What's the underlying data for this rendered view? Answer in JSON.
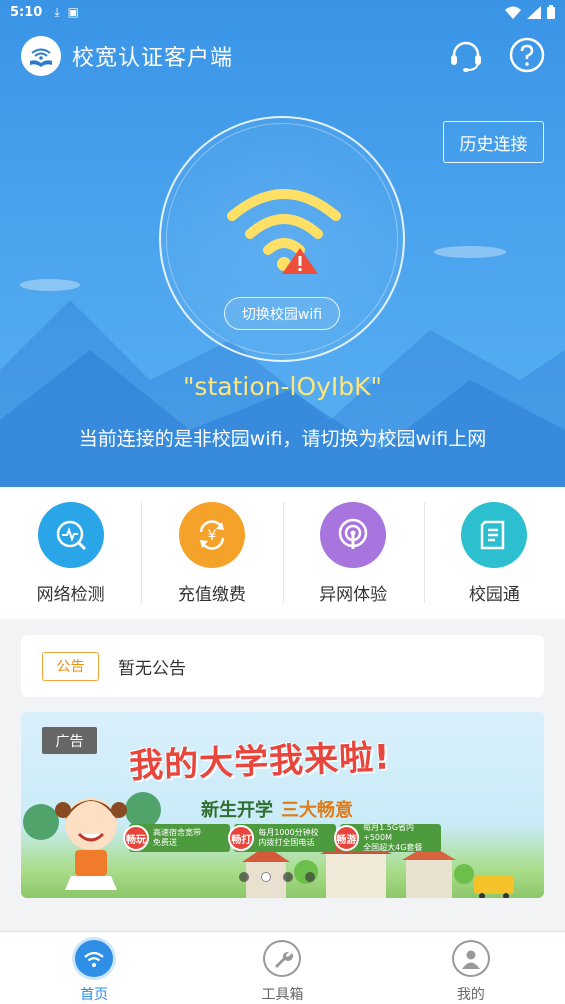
{
  "status_bar": {
    "time": "5:10"
  },
  "header": {
    "title": "校宽认证客户端",
    "support_icon": "headset-icon",
    "help_icon": "question-icon",
    "history_button": "历史连接"
  },
  "connection": {
    "switch_button": "切换校园wifi",
    "ssid": "\"station-lOyIbK\"",
    "message": "当前连接的是非校园wifi，请切换为校园wifi上网",
    "icon": "wifi-warning-icon"
  },
  "actions": [
    {
      "label": "网络检测",
      "icon": "network-check-icon",
      "color": "#2aa6e8"
    },
    {
      "label": "充值缴费",
      "icon": "yuan-refresh-icon",
      "color": "#f5a22a"
    },
    {
      "label": "异网体验",
      "icon": "broadcast-icon",
      "color": "#a874dd"
    },
    {
      "label": "校园通",
      "icon": "document-icon",
      "color": "#2bbfcf"
    }
  ],
  "announcement": {
    "tag": "公告",
    "text": "暂无公告"
  },
  "banner": {
    "tag": "广告",
    "headline": "我的大学我来啦!",
    "subtitle": "新生开学",
    "subtitle_accent": "三大畅意",
    "perks": [
      {
        "badge": "畅玩",
        "line1": "高速宿舍宽带",
        "line2": "免费送"
      },
      {
        "badge": "畅打",
        "line1": "每月1000分钟校",
        "line2": "内拨打全国电话"
      },
      {
        "badge": "畅游",
        "line1": "每月1.5G省内+500M",
        "line2": "全国超大4G套餐"
      }
    ],
    "active_slide": 2,
    "slide_count": 4
  },
  "bottom_nav": [
    {
      "label": "首页",
      "icon": "wifi-home-icon",
      "active": true
    },
    {
      "label": "工具箱",
      "icon": "wrench-icon",
      "active": false
    },
    {
      "label": "我的",
      "icon": "user-icon",
      "active": false
    }
  ],
  "colors": {
    "primary": "#3a94e6",
    "ssid": "#ffe57a",
    "accent_orange": "#e88e15",
    "nav_active": "#2f8fe6"
  }
}
